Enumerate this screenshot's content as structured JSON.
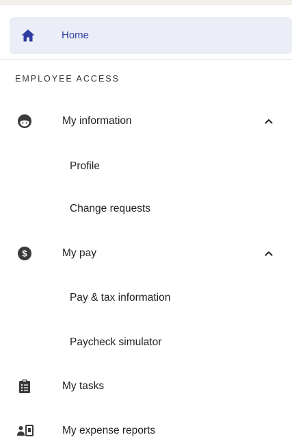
{
  "home": {
    "label": "Home",
    "icon": "home-icon",
    "accent": "#2f3c9f"
  },
  "section": {
    "heading": "EMPLOYEE ACCESS"
  },
  "my_information": {
    "label": "My information",
    "icon": "face-icon",
    "expanded": true,
    "children": [
      {
        "label": "Profile"
      },
      {
        "label": "Change requests"
      }
    ]
  },
  "my_pay": {
    "label": "My pay",
    "icon": "dollar-circle-icon",
    "expanded": true,
    "children": [
      {
        "label": "Pay & tax information"
      },
      {
        "label": "Paycheck simulator"
      }
    ]
  },
  "my_tasks": {
    "label": "My tasks",
    "icon": "clipboard-list-icon"
  },
  "my_expense_reports": {
    "label": "My expense reports",
    "icon": "expense-report-icon"
  }
}
